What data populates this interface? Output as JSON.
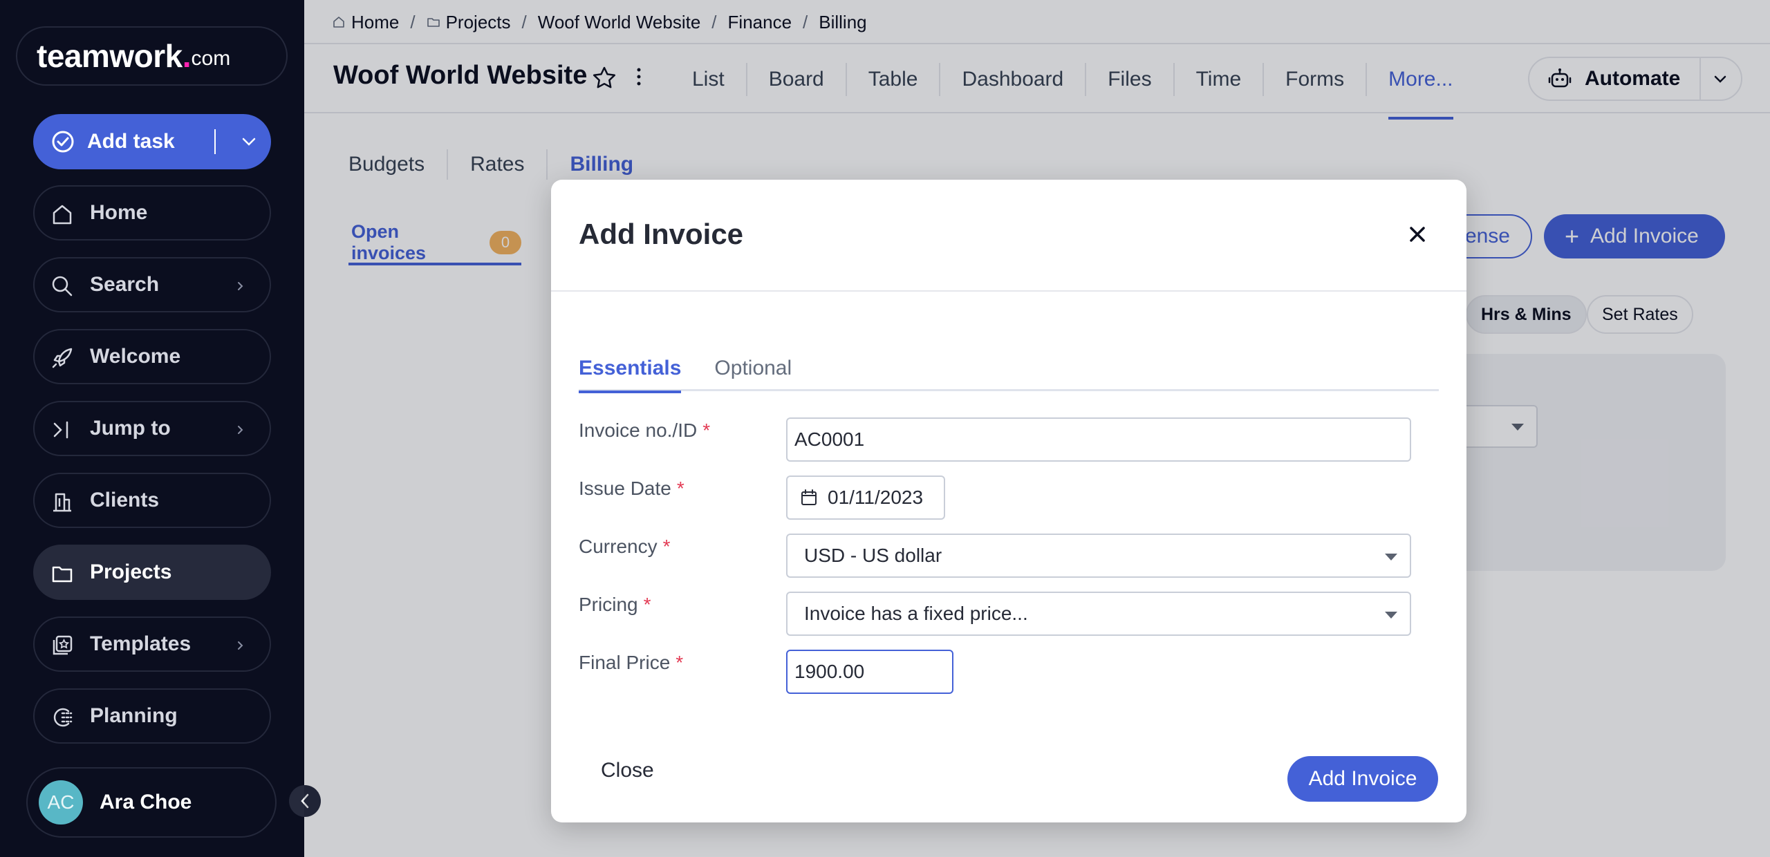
{
  "sidebar": {
    "logo": {
      "main": "teamwork",
      "dot": ".",
      "suffix": "com"
    },
    "add_task": "Add task",
    "items": [
      {
        "label": "Home",
        "icon": "home-icon"
      },
      {
        "label": "Search",
        "icon": "search-icon"
      },
      {
        "label": "Welcome",
        "icon": "rocket-icon"
      },
      {
        "label": "Jump to",
        "icon": "jump-icon"
      },
      {
        "label": "Clients",
        "icon": "building-icon"
      },
      {
        "label": "Projects",
        "icon": "folder-icon"
      },
      {
        "label": "Templates",
        "icon": "templates-icon"
      },
      {
        "label": "Planning",
        "icon": "planning-icon"
      }
    ],
    "user": {
      "initials": "AC",
      "name": "Ara Choe"
    }
  },
  "breadcrumb": [
    "Home",
    "Projects",
    "Woof World Website",
    "Finance",
    "Billing"
  ],
  "project": {
    "title": "Woof World Website",
    "tabs": [
      "List",
      "Board",
      "Table",
      "Dashboard",
      "Files",
      "Time",
      "Forms",
      "More..."
    ],
    "automate": "Automate"
  },
  "finance": {
    "subtabs": [
      "Budgets",
      "Rates",
      "Billing"
    ],
    "open_invoices": {
      "label": "Open invoices",
      "count": "0"
    },
    "expense_button": "ense",
    "add_invoice_button": "Add Invoice",
    "chips": {
      "hrs": "Hrs & Mins",
      "rates": "Set Rates"
    }
  },
  "modal": {
    "title": "Add Invoice",
    "tabs": [
      "Essentials",
      "Optional"
    ],
    "required_mark": "*",
    "fields": {
      "invoice_id": {
        "label": "Invoice no./ID",
        "value": "AC0001"
      },
      "issue_date": {
        "label": "Issue Date",
        "value": "01/11/2023"
      },
      "currency": {
        "label": "Currency",
        "value": "USD - US dollar"
      },
      "pricing": {
        "label": "Pricing",
        "value": "Invoice has a fixed price..."
      },
      "final_price": {
        "label": "Final Price",
        "value": "1900.00"
      }
    },
    "close_label": "Close",
    "submit_label": "Add Invoice"
  },
  "colors": {
    "accent": "#4461d7",
    "sidebar_bg": "#0b0e1f",
    "required": "#e33b54",
    "badge": "#f4b35e",
    "logo_dot": "#ff22b1"
  }
}
